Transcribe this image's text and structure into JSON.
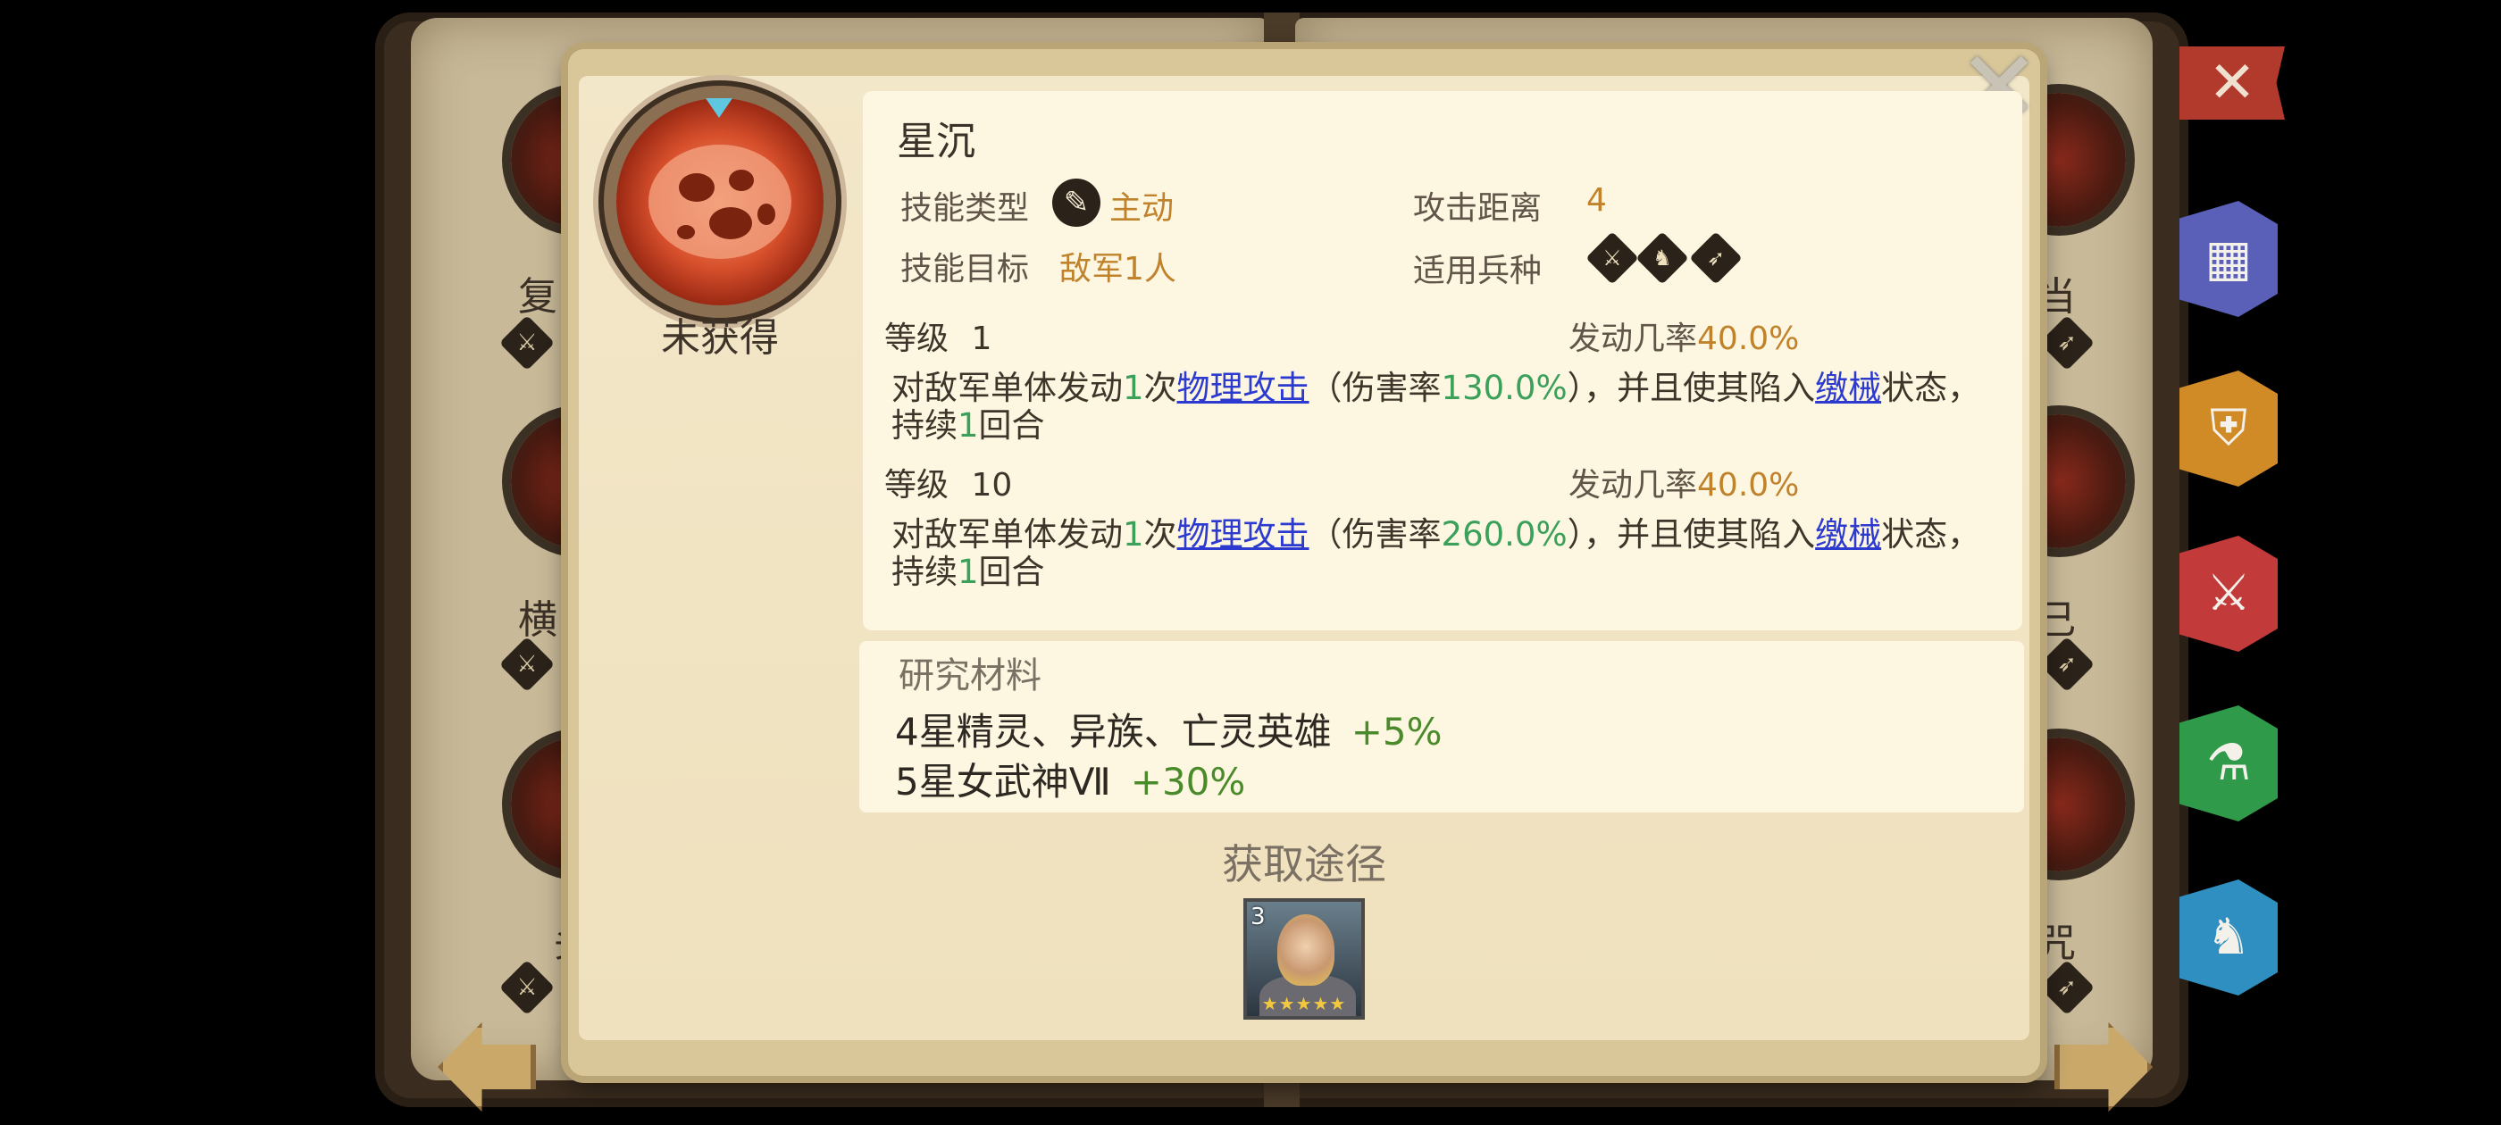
{
  "background": {
    "left_labels": [
      "复",
      "横",
      "头"
    ],
    "right_labels": [
      "当",
      "己",
      "咒"
    ],
    "nav_left_icon": "arrow-left-icon",
    "nav_right_icon": "arrow-right-icon",
    "side_close_icon": "close-icon",
    "side_tabs": [
      {
        "icon": "grid-icon",
        "color": "#5a5fb8"
      },
      {
        "icon": "shield-icon",
        "color": "#d08a26"
      },
      {
        "icon": "sword-icon",
        "color": "#c23a3a"
      },
      {
        "icon": "flask-icon",
        "color": "#2f9a4a"
      },
      {
        "icon": "horse-icon",
        "color": "#2f8fc0"
      }
    ]
  },
  "skill": {
    "icon": "fire-skill-icon",
    "status": "未获得",
    "name": "星沉",
    "type_label": "技能类型",
    "type_value": "主动",
    "target_label": "技能目标",
    "target_value": "敌军1人",
    "range_label": "攻击距离",
    "range_value": "4",
    "troop_label": "适用兵种",
    "troop_icons": [
      "infantry-icon",
      "cavalry-icon",
      "archer-icon"
    ]
  },
  "levels": [
    {
      "label": "等级",
      "level": "1",
      "rate_label": "发动几率",
      "rate": "40.0%",
      "desc": {
        "p1": "对敌军单体发动",
        "times": "1",
        "p2": "次",
        "link1": "物理攻击",
        "p3": "（伤害率",
        "dmg": "130.0%",
        "p4": "），并且使其陷入",
        "link2": "缴械",
        "p5": "状态，持续",
        "turns": "1",
        "p6": "回合"
      }
    },
    {
      "label": "等级",
      "level": "10",
      "rate_label": "发动几率",
      "rate": "40.0%",
      "desc": {
        "p1": "对敌军单体发动",
        "times": "1",
        "p2": "次",
        "link1": "物理攻击",
        "p3": "（伤害率",
        "dmg": "260.0%",
        "p4": "），并且使其陷入",
        "link2": "缴械",
        "p5": "状态，持续",
        "turns": "1",
        "p6": "回合"
      }
    }
  ],
  "materials": {
    "title": "研究材料",
    "items": [
      {
        "name": "4星精灵、异族、亡灵英雄",
        "bonus": "+5%"
      },
      {
        "name": "5星女武神Ⅶ",
        "bonus": "+30%"
      }
    ]
  },
  "obtain": {
    "title": "获取途径",
    "hero_badge": "3",
    "hero_stars": "★★★★★"
  },
  "close_label": "✕"
}
